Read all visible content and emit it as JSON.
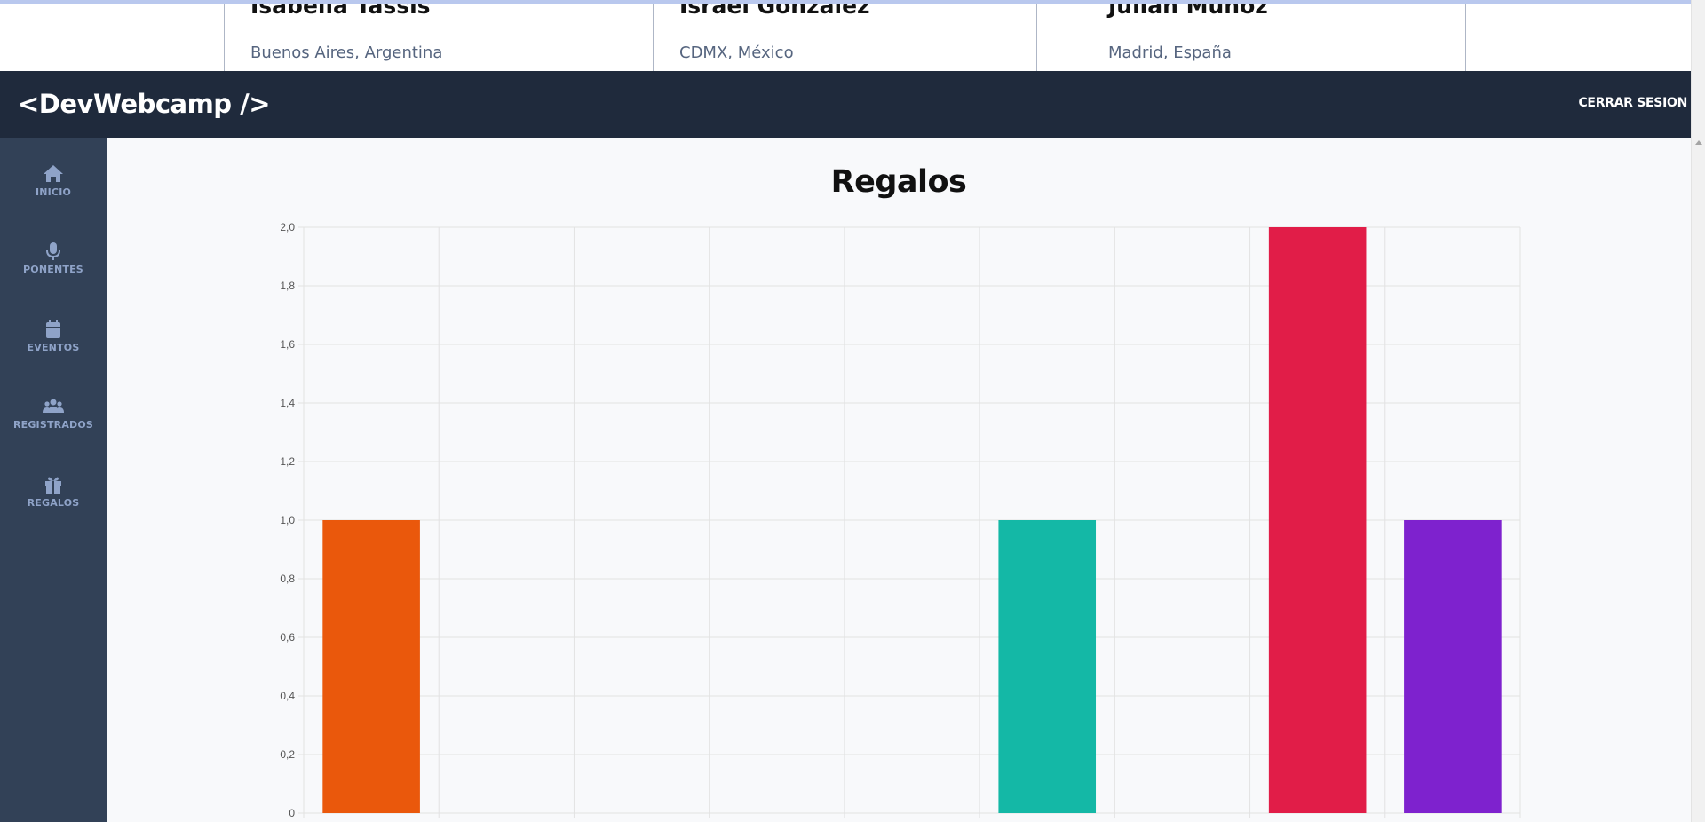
{
  "speakers": [
    {
      "name": "Isabella Tassis",
      "location": "Buenos Aires, Argentina"
    },
    {
      "name": "Israel González",
      "location": "CDMX, México"
    },
    {
      "name": "Julián Muñoz",
      "location": "Madrid, España"
    }
  ],
  "header": {
    "logo": "<DevWebcamp />",
    "logout_label": "CERRAR SESION"
  },
  "sidebar": {
    "items": [
      {
        "label": "INICIO",
        "icon": "home-icon"
      },
      {
        "label": "PONENTES",
        "icon": "microphone-icon"
      },
      {
        "label": "EVENTOS",
        "icon": "calendar-icon"
      },
      {
        "label": "REGISTRADOS",
        "icon": "users-icon"
      },
      {
        "label": "REGALOS",
        "icon": "gift-icon"
      }
    ],
    "icon_color": "#8fa3c8"
  },
  "main": {
    "title": "Regalos"
  },
  "chart_data": {
    "type": "bar",
    "title": "Regalos",
    "categories": [
      "",
      "",
      "",
      "",
      "",
      "",
      "",
      "",
      ""
    ],
    "values": [
      1,
      0,
      0,
      0,
      0,
      1,
      0,
      2,
      1
    ],
    "colors": [
      "#ea580c",
      "#84cc16",
      "#65a30d",
      "#0d9488",
      "#2563eb",
      "#14b8a6",
      "#3b82f6",
      "#e11d48",
      "#7e22ce"
    ],
    "ylim": [
      0,
      2
    ],
    "yticks": [
      "0",
      "0,2",
      "0,4",
      "0,6",
      "0,8",
      "1,0",
      "1,2",
      "1,4",
      "1,6",
      "1,8",
      "2,0"
    ],
    "grid": true,
    "xlabel": "",
    "ylabel": ""
  }
}
